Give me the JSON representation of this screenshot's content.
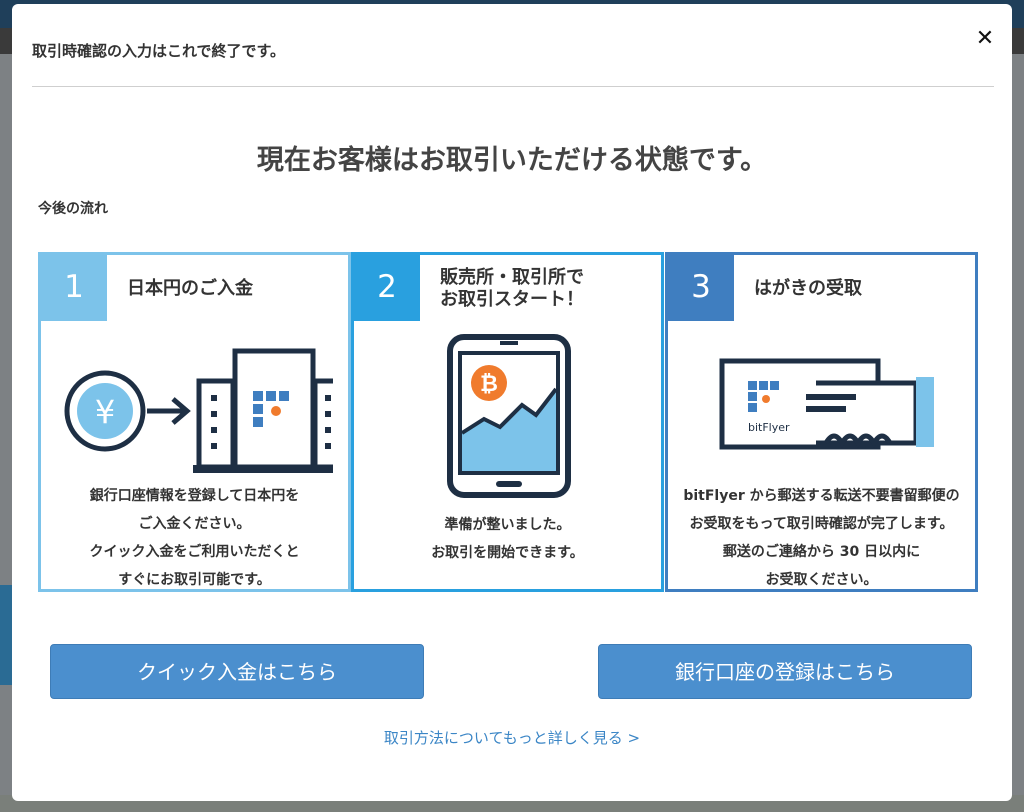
{
  "modal": {
    "header_title": "取引時確認の入力はこれで終了です。",
    "close_glyph": "✕",
    "headline": "現在お客様はお取引いただける状態です。",
    "flow_label": "今後の流れ"
  },
  "steps": [
    {
      "number": "1",
      "title_line1": "日本円のご入金",
      "desc": [
        "銀行口座情報を登録して日本円を",
        "ご入金ください。",
        "クイック入金をご利用いただくと",
        "すぐにお取引可能です。"
      ],
      "yen_symbol": "¥"
    },
    {
      "number": "2",
      "title_line1": "販売所・取引所で",
      "title_line2": "お取引スタート！",
      "desc": [
        "準備が整いました。",
        "お取引を開始できます。"
      ],
      "coin_symbol": "₿"
    },
    {
      "number": "3",
      "title_line1": "はがきの受取",
      "desc": [
        "bitFlyer から郵送する転送不要書留郵便の",
        "お受取をもって取引時確認が完了します。",
        "郵送のご連絡から 30 日以内に",
        "お受取ください。"
      ],
      "card_brand": "bitFlyer"
    }
  ],
  "buttons": {
    "quick_deposit": "クイック入金はこちら",
    "bank_register": "銀行口座の登録はこちら"
  },
  "more_link": "取引方法についてもっと詳しく見る >",
  "colors": {
    "step1": "#7cc3ea",
    "step2": "#29a0df",
    "step3": "#3f7ec0",
    "button": "#4b8fce",
    "link": "#3b86c6"
  }
}
